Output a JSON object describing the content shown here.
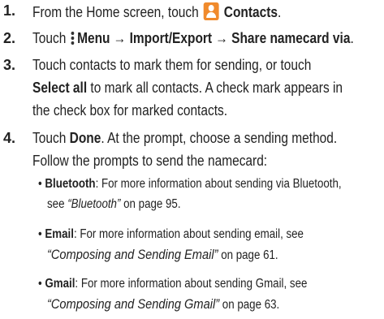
{
  "steps": [
    {
      "number": "1.",
      "text_before": "From the Home screen, touch",
      "bold": "Contacts",
      "text_after": "."
    },
    {
      "number": "2.",
      "touch": "Touch",
      "menu_path": "Menu → Import/Export → Share namecard via",
      "period": "."
    },
    {
      "number": "3.",
      "line1": "Touch contacts to mark them for sending, or touch",
      "line2_bold": "Select all",
      "line2_rest": "to mark all contacts. A check mark appears in",
      "line3": "the check box for marked contacts."
    },
    {
      "number": "4.",
      "line1_pre": "Touch",
      "line1_bold": "Done",
      "line1_rest": ". At the prompt, choose a sending method.",
      "line2": "Follow the prompts to send the namecard:"
    }
  ],
  "bullets": [
    {
      "label": "Bluetooth",
      "line1_rest": ": For more information about sending via Bluetooth,",
      "line2_pre": "see",
      "ref": "“Bluetooth”",
      "line2_post": "on page 95."
    },
    {
      "label": "Email",
      "line1_rest": ": For more information about sending email, see",
      "ref": "“Composing and Sending Email”",
      "line2_post": "on page 61."
    },
    {
      "label": "Gmail",
      "line1_rest": ": For more information about sending Gmail, see",
      "ref": "“Composing and Sending Gmail”",
      "line2_post": "on page 63."
    }
  ],
  "icons": {
    "contacts": "contacts-icon",
    "menu": "menu-icon"
  },
  "colors": {
    "contacts_icon": "#f08a2c"
  }
}
